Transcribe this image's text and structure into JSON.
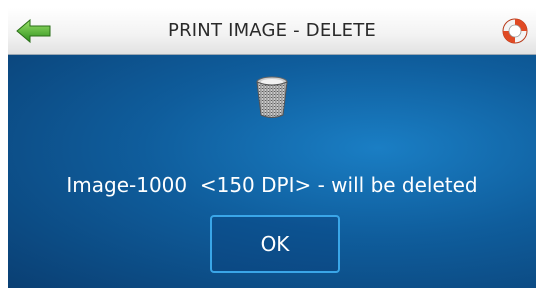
{
  "header": {
    "title": "PRINT IMAGE - DELETE",
    "back_icon": "back-arrow-icon",
    "help_icon": "lifebuoy-icon"
  },
  "dialog": {
    "icon": "trash-bin-icon",
    "message": "Image-1000  <150 DPI> - will be deleted",
    "ok_label": "OK"
  },
  "colors": {
    "background_dark": "#0a3f73",
    "background_light": "#1a7ec4",
    "button_border": "#3aa6e8",
    "back_arrow": "#4caf2f",
    "help_ring": "#e04a24"
  }
}
